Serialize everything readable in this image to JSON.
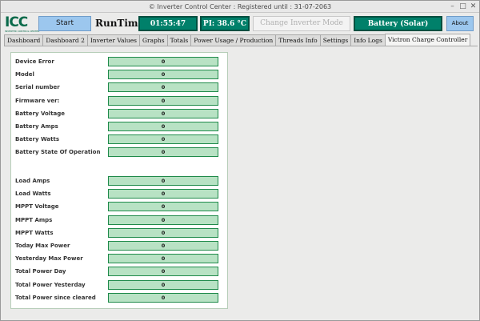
{
  "window": {
    "title": "© Inverter Control Center : Registered until : 31-07-2063",
    "min_glyph": "–",
    "max_glyph": "□",
    "close_glyph": "✕"
  },
  "header": {
    "logo_text": "ICC",
    "logo_sub": "INVERTER CONTROL CENTER",
    "start_label": "Start",
    "runtime_label": "RunTime",
    "clock": "01:55:47",
    "pi_temp": "PI: 38.6 °C",
    "inverter_mode_label": "Change Inverter Mode",
    "battery_source": "Battery (Solar)",
    "about_label": "About"
  },
  "tabs": [
    {
      "label": "Dashboard"
    },
    {
      "label": "Dashboard 2"
    },
    {
      "label": "Inverter Values"
    },
    {
      "label": "Graphs"
    },
    {
      "label": "Totals"
    },
    {
      "label": "Power Usage / Production"
    },
    {
      "label": "Threads Info"
    },
    {
      "label": "Settings"
    },
    {
      "label": "Info Logs"
    },
    {
      "label": "Victron Charge Controller"
    }
  ],
  "active_tab": 9,
  "fields_top": [
    {
      "label": "Device Error",
      "value": "0"
    },
    {
      "label": "Model",
      "value": "0"
    },
    {
      "label": "Serial number",
      "value": "0"
    },
    {
      "label": "Firmware ver:",
      "value": "0"
    },
    {
      "label": "Battery Voltage",
      "value": "0"
    },
    {
      "label": "Battery Amps",
      "value": "0"
    },
    {
      "label": "Battery Watts",
      "value": "0"
    },
    {
      "label": "Battery State Of Operation",
      "value": "0"
    }
  ],
  "fields_bottom": [
    {
      "label": "Load Amps",
      "value": "0"
    },
    {
      "label": "Load Watts",
      "value": "0"
    },
    {
      "label": "MPPT Voltage",
      "value": "0"
    },
    {
      "label": "MPPT Amps",
      "value": "0"
    },
    {
      "label": "MPPT Watts",
      "value": "0"
    },
    {
      "label": "Today Max Power",
      "value": "0"
    },
    {
      "label": "Yesterday Max Power",
      "value": "0"
    },
    {
      "label": "Total Power Day",
      "value": "0"
    },
    {
      "label": "Total Power Yesterday",
      "value": "0"
    },
    {
      "label": "Total Power since cleared",
      "value": "0"
    }
  ]
}
